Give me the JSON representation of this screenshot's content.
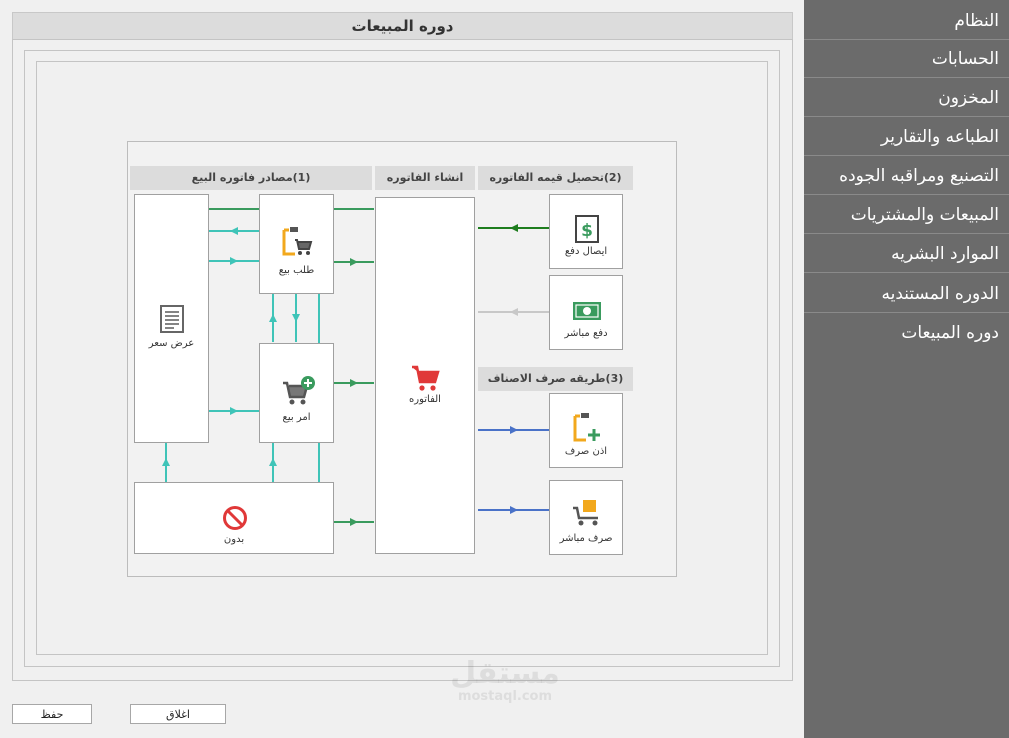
{
  "window_title": "دوره المبيعات",
  "sidebar": {
    "items": [
      {
        "label": "النظام"
      },
      {
        "label": "الحسابات"
      },
      {
        "label": "المخزون"
      },
      {
        "label": "الطباعه والتقارير"
      },
      {
        "label": "التصنيع ومراقبه الجوده"
      },
      {
        "label": "المبيعات والمشتريات"
      },
      {
        "label": "الموارد البشريه"
      },
      {
        "label": "الدوره المستنديه"
      },
      {
        "label": "دوره المبيعات"
      }
    ]
  },
  "diagram": {
    "headers": {
      "sources": "(1)مصادر فاتوره البيع",
      "create": "انشاء الفاتوره",
      "collect": "(2)تحصيل قيمه الفاتوره",
      "dispatch": "(3)طريقه صرف الاصناف"
    },
    "boxes": {
      "quote": "عرض سعر",
      "sales_request": "طلب بيع",
      "sales_order": "امر بيع",
      "none": "بدون",
      "invoice": "الفاتوره",
      "payment_receipt": "ايصال دفع",
      "direct_payment": "دفع مباشر",
      "dispatch_permit": "اذن صرف",
      "direct_dispatch": "صرف مباشر"
    },
    "colors": {
      "teal": "#3fc4b8",
      "green": "#3a9b5e",
      "dark_green": "#1e7d1e",
      "gray": "#c8c8c8",
      "blue": "#4a72c8",
      "orange": "#f2a81d",
      "red": "#e03838"
    },
    "icons": [
      "document-icon",
      "clipboard-cart-icon",
      "cart-add-icon",
      "no-entry-icon",
      "shopping-cart-icon",
      "dollar-receipt-icon",
      "cash-icon",
      "clipboard-plus-icon",
      "cart-box-icon"
    ]
  },
  "buttons": {
    "save": "حفظ",
    "close": "اغلاق"
  },
  "watermark": {
    "arabic": "مستقل",
    "latin": "mostaql.com"
  }
}
